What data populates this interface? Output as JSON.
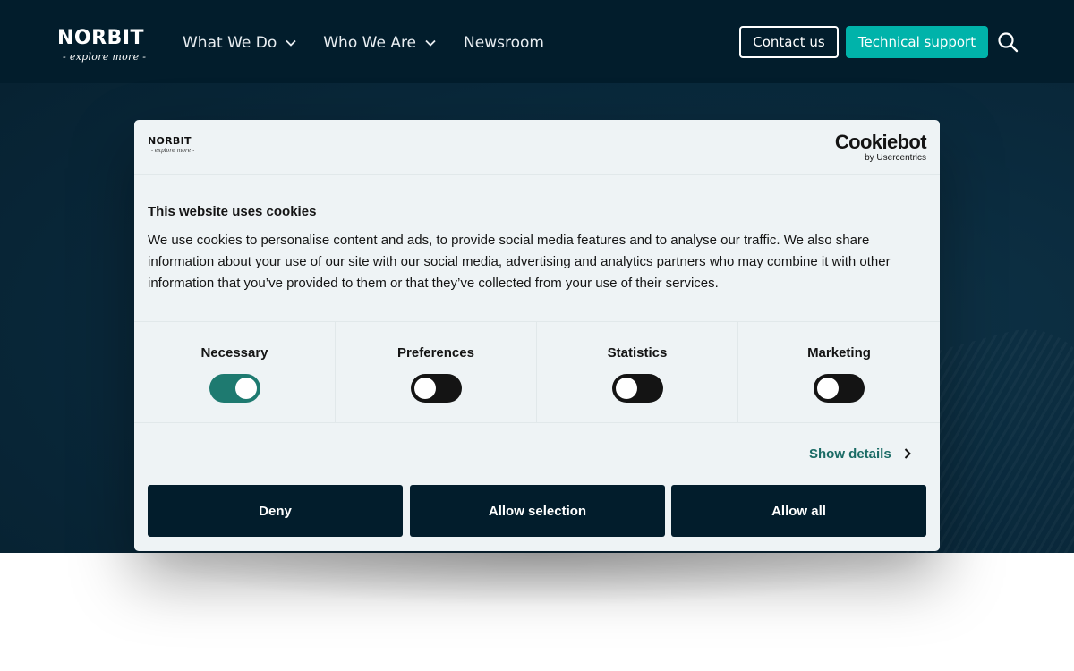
{
  "site": {
    "logo_word": "NORBIT",
    "logo_tagline": "- explore more -"
  },
  "nav": {
    "items": [
      {
        "label": "What We Do",
        "has_dropdown": true
      },
      {
        "label": "Who We Are",
        "has_dropdown": true
      },
      {
        "label": "Newsroom",
        "has_dropdown": false
      }
    ],
    "contact_label": "Contact us",
    "support_label": "Technical support",
    "search_icon": "search-icon"
  },
  "cookie_dialog": {
    "brand_logo_word": "NORBIT",
    "brand_logo_tagline": "- explore more -",
    "provider_word": "Cookiebot",
    "provider_by": "by Usercentrics",
    "title": "This website uses cookies",
    "body": "We use cookies to personalise content and ads, to provide social media features and to analyse our traffic. We also share information about your use of our site with our social media, advertising and analytics partners who may combine it with other information that you’ve provided to them or that they’ve collected from your use of their services.",
    "categories": [
      {
        "label": "Necessary",
        "enabled": true
      },
      {
        "label": "Preferences",
        "enabled": false
      },
      {
        "label": "Statistics",
        "enabled": false
      },
      {
        "label": "Marketing",
        "enabled": false
      }
    ],
    "show_details_label": "Show details",
    "buttons": {
      "deny": "Deny",
      "allow_selection": "Allow selection",
      "allow_all": "Allow all"
    }
  },
  "colors": {
    "nav_bg": "#021d2c",
    "accent_teal": "#00b3aa",
    "toggle_on": "#1e7a70",
    "dialog_bg": "#eef3f5",
    "link_teal": "#1a6b65"
  }
}
